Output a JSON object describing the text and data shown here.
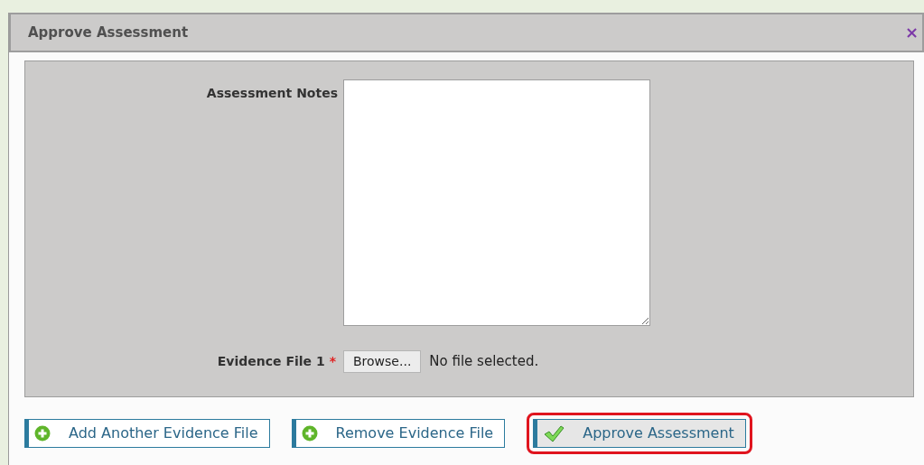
{
  "dialog": {
    "title": "Approve Assessment",
    "close": "×"
  },
  "form": {
    "notes_label": "Assessment Notes",
    "file_label": "Evidence File 1",
    "required_mark": "*",
    "browse": "Browse...",
    "file_status": "No file selected."
  },
  "buttons": [
    {
      "label": "Add Another Evidence File",
      "kind": "plus",
      "highlighted": false
    },
    {
      "label": "Remove Evidence File",
      "kind": "plus",
      "highlighted": false
    },
    {
      "label": "Approve Assessment",
      "kind": "check",
      "highlighted": true
    }
  ]
}
